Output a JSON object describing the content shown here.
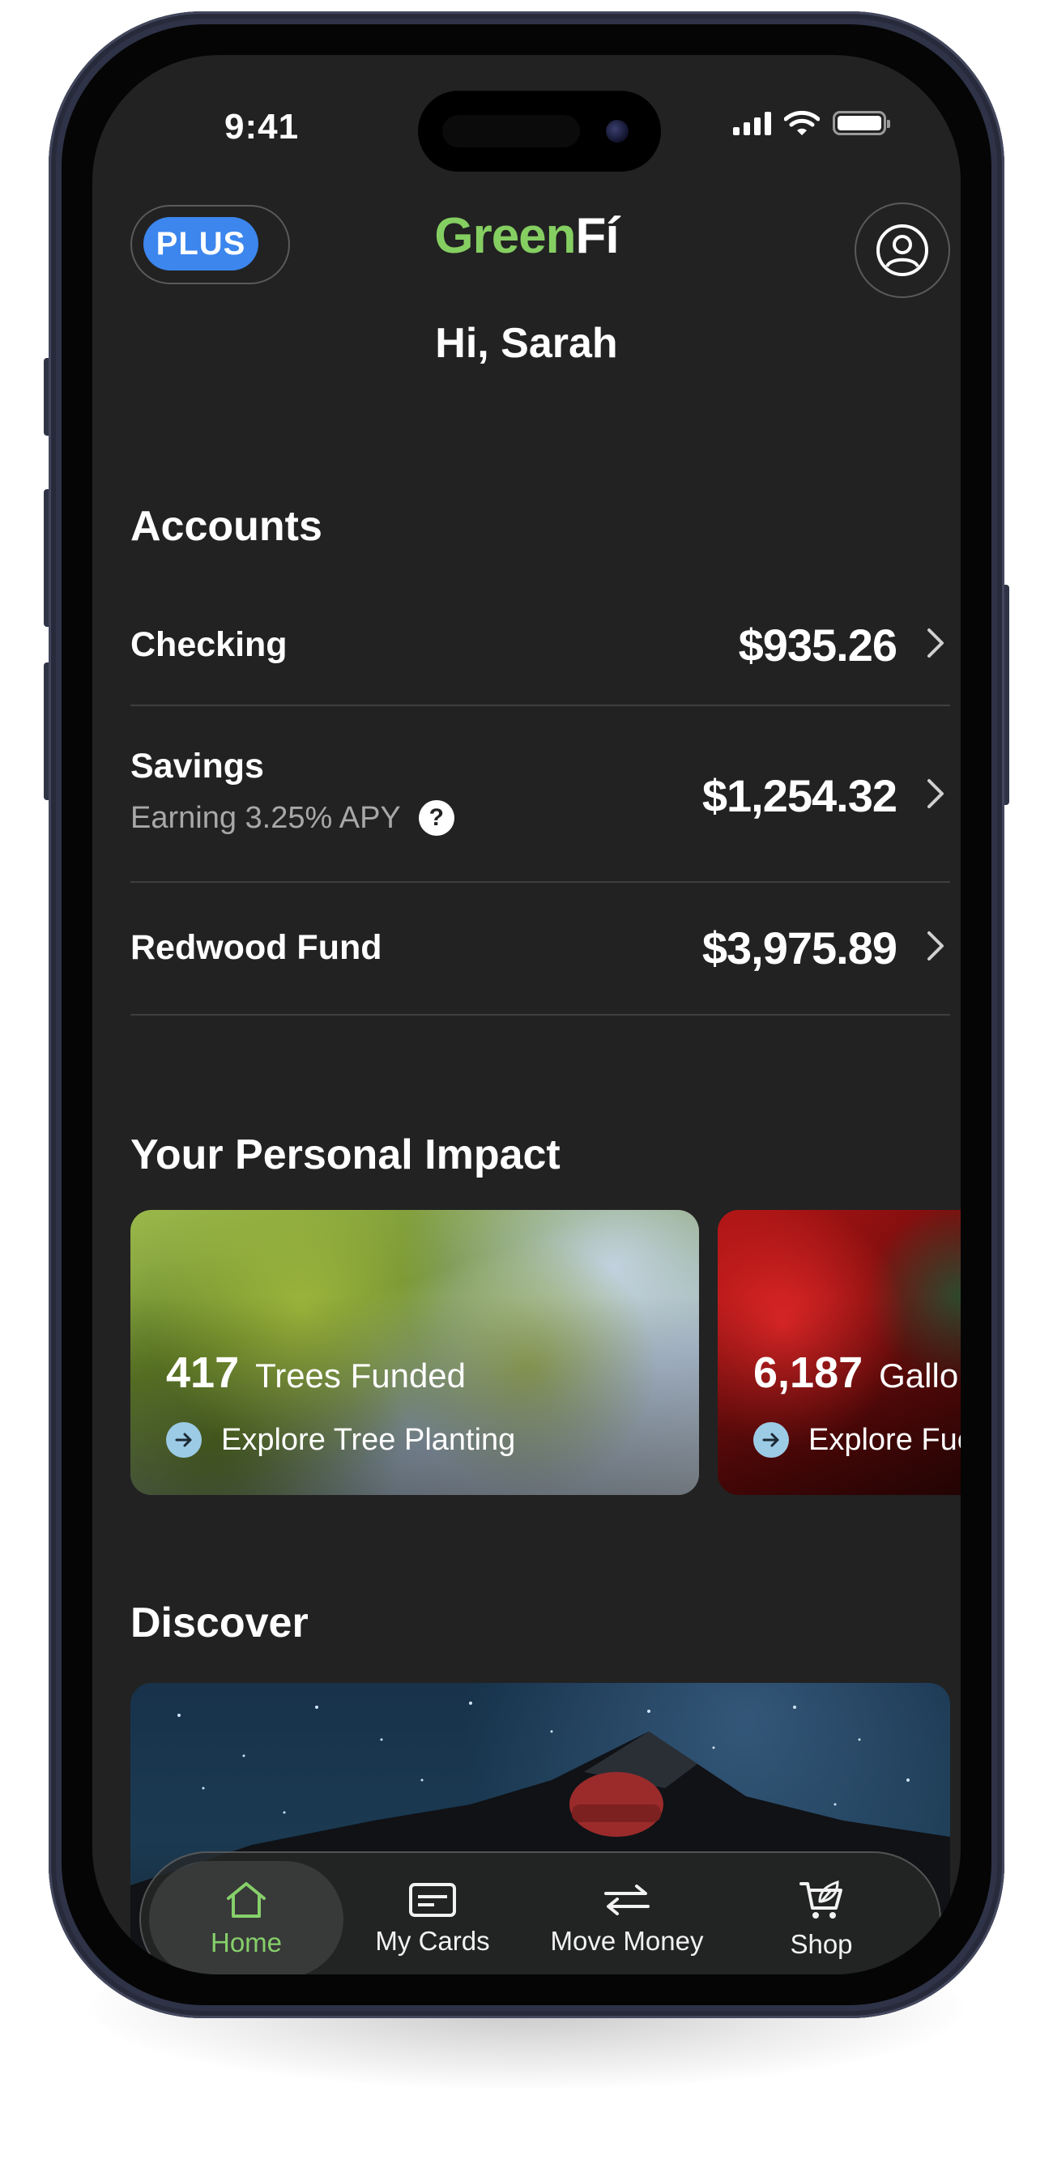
{
  "status_bar": {
    "time": "9:41"
  },
  "header": {
    "plus_badge": "PLUS",
    "logo_main": "Green",
    "logo_accent": "Fí",
    "greeting": "Hi, Sarah"
  },
  "accounts": {
    "title": "Accounts",
    "items": [
      {
        "name": "Checking",
        "amount": "$935.26"
      },
      {
        "name": "Savings",
        "subtitle": "Earning 3.25% APY",
        "amount": "$1,254.32"
      },
      {
        "name": "Redwood Fund",
        "amount": "$3,975.89"
      }
    ]
  },
  "impact": {
    "title": "Your Personal Impact",
    "cards": [
      {
        "value": "417",
        "label": "Trees Funded",
        "link": "Explore Tree Planting"
      },
      {
        "value": "6,187",
        "label": "Gallons",
        "link": "Explore Fuel"
      }
    ]
  },
  "discover": {
    "title": "Discover"
  },
  "tabbar": {
    "items": [
      {
        "label": "Home",
        "icon": "home-icon",
        "active": true
      },
      {
        "label": "My Cards",
        "icon": "card-icon"
      },
      {
        "label": "Move Money",
        "icon": "transfer-icon"
      },
      {
        "label": "Shop",
        "icon": "cart-icon"
      }
    ]
  },
  "colors": {
    "brand_green": "#85cf62",
    "plus_blue": "#3c86ee",
    "background": "#222222"
  }
}
